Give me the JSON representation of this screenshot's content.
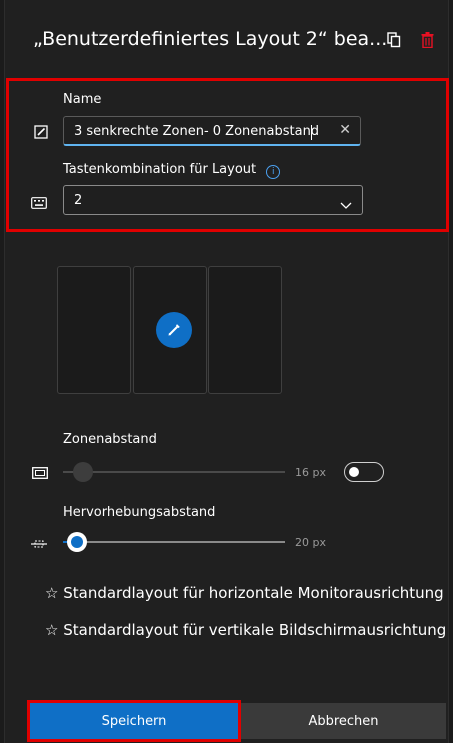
{
  "header": {
    "title": "„Benutzerdefiniertes Layout 2“ bea...",
    "icons": [
      "copy-icon",
      "delete-icon"
    ]
  },
  "name_field": {
    "label": "Name",
    "value": "3 senkrechte Zonen- 0 Zonenabstand",
    "clear_symbol": "✕"
  },
  "shortcut_field": {
    "label": "Tastenkombination für Layout",
    "value": "2"
  },
  "zone_spacing": {
    "label": "Zonenabstand",
    "value_text": "16 px",
    "level": 0.1,
    "enabled": false
  },
  "highlight_spacing": {
    "label": "Hervorhebungsabstand",
    "value_text": "20 px",
    "level": 0.05
  },
  "defaults": {
    "horizontal": "Standardlayout für horizontale Monitorausrichtung",
    "vertical": "Standardlayout für vertikale Bildschirmausrichtung",
    "star_symbol": "☆"
  },
  "footer": {
    "save_label": "Speichern",
    "cancel_label": "Abbrechen"
  },
  "colors": {
    "accent": "#0f6fc6",
    "highlight_red": "#e00000",
    "delete_red": "#e81123",
    "info_blue": "#4ba0f0"
  }
}
